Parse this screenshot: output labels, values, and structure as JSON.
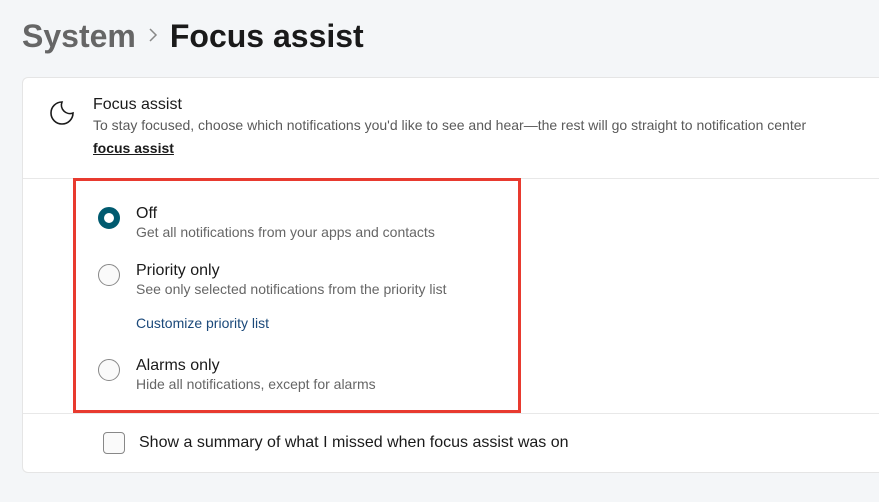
{
  "breadcrumb": {
    "parent": "System",
    "current": "Focus assist"
  },
  "header": {
    "title": "Focus assist",
    "description": "To stay focused, choose which notifications you'd like to see and hear—the rest will go straight to notification center",
    "link": "focus assist"
  },
  "options": [
    {
      "id": "off",
      "title": "Off",
      "description": "Get all notifications from your apps and contacts",
      "selected": true
    },
    {
      "id": "priority",
      "title": "Priority only",
      "description": "See only selected notifications from the priority list",
      "selected": false,
      "sublink": "Customize priority list"
    },
    {
      "id": "alarms",
      "title": "Alarms only",
      "description": "Hide all notifications, except for alarms",
      "selected": false
    }
  ],
  "summary": {
    "label": "Show a summary of what I missed when focus assist was on",
    "checked": false
  }
}
